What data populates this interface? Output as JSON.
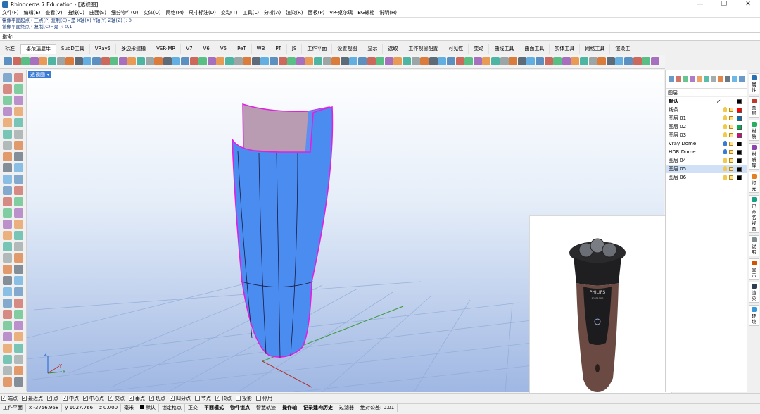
{
  "window": {
    "title": "Rhinoceros 7 Education - [透视图]",
    "controls": [
      "—",
      "❐",
      "✕"
    ]
  },
  "menu": [
    "文件(F)",
    "编辑(E)",
    "查看(V)",
    "曲线(C)",
    "曲面(S)",
    "细分物件(U)",
    "实体(O)",
    "网格(M)",
    "尺寸标注(D)",
    "变动(T)",
    "工具(L)",
    "分析(A)",
    "渲染(R)",
    "面板(P)",
    "VR-桌尔璃",
    "BG螺栓",
    "说明(H)"
  ],
  "command_history": [
    "镜像平面起点 ( 三点(P)  复制(C)=是  X轴(X)  Y轴(Y)  Z轴(Z) ): 0",
    "镜像平面终点 ( 复制(C)=是 ): 0,1"
  ],
  "command_prompt": "指令:",
  "tabs": [
    "标准",
    "桌尔璃犀牛",
    "SubD工具",
    "VRay5",
    "多边形建模",
    "VSR-MR",
    "V7",
    "V6",
    "V5",
    "PeT",
    "WB",
    "PT",
    "JS",
    "工作平面",
    "设置视图",
    "显示",
    "选取",
    "工作视窗配置",
    "可见性",
    "变动",
    "曲线工具",
    "曲面工具",
    "实体工具",
    "网格工具",
    "渲染工"
  ],
  "viewport": {
    "label": "透视图",
    "arrow": "▾",
    "axes": {
      "x": "x",
      "y": "y",
      "z": "z"
    }
  },
  "layers_panel": {
    "header": "图层",
    "layers": [
      {
        "name": "默认",
        "check": "✓",
        "color": "#000000",
        "bold": true
      },
      {
        "name": "线条",
        "color": "#ff0000"
      },
      {
        "name": "图层 01",
        "color": "#0070c0"
      },
      {
        "name": "图层 02",
        "color": "#00b050"
      },
      {
        "name": "图层 03",
        "color": "#e0007a"
      },
      {
        "name": "Vray Dome",
        "color": "#000000"
      },
      {
        "name": "HDR Dome",
        "color": "#000000"
      },
      {
        "name": "图层 04",
        "color": "#000000"
      },
      {
        "name": "图层 05",
        "color": "#000000",
        "selected": true
      },
      {
        "name": "图层 06",
        "color": "#000000"
      }
    ]
  },
  "side_tabs": [
    "属性",
    "图层",
    "材质",
    "材质库",
    "灯光",
    "已命名视图",
    "说明",
    "显示",
    "渲染",
    "环境"
  ],
  "reference_photo": {
    "brand": "PHILIPS",
    "model": "S1 S1000"
  },
  "osnaps": [
    {
      "label": "端点",
      "checked": true
    },
    {
      "label": "最近点",
      "checked": true
    },
    {
      "label": "点",
      "checked": true
    },
    {
      "label": "中点",
      "checked": true
    },
    {
      "label": "中心点",
      "checked": true
    },
    {
      "label": "交点",
      "checked": true
    },
    {
      "label": "垂点",
      "checked": true
    },
    {
      "label": "切点",
      "checked": true
    },
    {
      "label": "四分点",
      "checked": true
    },
    {
      "label": "节点",
      "checked": false
    },
    {
      "label": "顶点",
      "checked": true
    },
    {
      "label": "投影",
      "checked": false
    },
    {
      "label": "停用",
      "checked": false
    }
  ],
  "status": {
    "cplane": "工作平面",
    "x": "x -3756.968",
    "y": "y 1027.766",
    "z": "z 0.000",
    "units": "毫米",
    "layer": "默认",
    "toggles": [
      "锁定格点",
      "正交",
      "平面模式",
      "物件锁点",
      "智慧轨迹",
      "操作轴",
      "记录建构历史",
      "过滤器"
    ],
    "tolerance": "绝对公差: 0.01"
  },
  "colors": {
    "model_surface": "#4a8cf0",
    "edge_highlight": "#e020e0",
    "selected_layer": "#cfe0f7",
    "viewport_bottom": "#9fb7e3"
  }
}
